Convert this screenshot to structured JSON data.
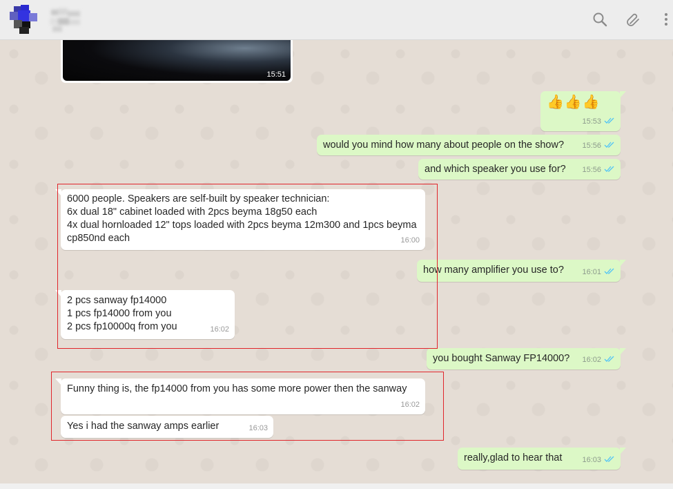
{
  "header": {
    "contact_name": "",
    "icons": [
      "search-icon",
      "attach-icon",
      "menu-icon"
    ]
  },
  "messages": [
    {
      "dir": "in",
      "kind": "image",
      "time": "15:51"
    },
    {
      "dir": "out",
      "text": "👍👍👍",
      "time": "15:53",
      "status": "read"
    },
    {
      "dir": "out",
      "text": "would you mind how many about people on the show?",
      "time": "15:56",
      "status": "read"
    },
    {
      "dir": "out",
      "text": "and which speaker you use for?",
      "time": "15:56",
      "status": "read"
    },
    {
      "dir": "in",
      "text": "6000 people. Speakers are self-built by speaker technician:\n6x dual 18\" cabinet loaded with 2pcs beyma 18g50 each\n4x dual hornloaded 12\" tops loaded with 2pcs beyma 12m300 and 1pcs beyma cp850nd each",
      "time": "16:00"
    },
    {
      "dir": "out",
      "text": "how many amplifier you use to?",
      "time": "16:01",
      "status": "read"
    },
    {
      "dir": "in",
      "text": "2 pcs sanway fp14000\n1 pcs fp14000 from you\n2 pcs fp10000q from you",
      "time": "16:02"
    },
    {
      "dir": "out",
      "text": "you bought Sanway FP14000?",
      "time": "16:02",
      "status": "read"
    },
    {
      "dir": "in",
      "text": "Funny thing is, the fp14000 from you has some more power then the sanway",
      "time": "16:02"
    },
    {
      "dir": "in",
      "text": "Yes i had the sanway amps earlier",
      "time": "16:03"
    },
    {
      "dir": "out",
      "text": "really,glad to hear that",
      "time": "16:03",
      "status": "read"
    }
  ],
  "colors": {
    "outgoing": "#dcf8c6",
    "incoming": "#ffffff",
    "read_ticks": "#4fc3f7",
    "highlight_box": "#e0242a",
    "header": "#ededed"
  }
}
